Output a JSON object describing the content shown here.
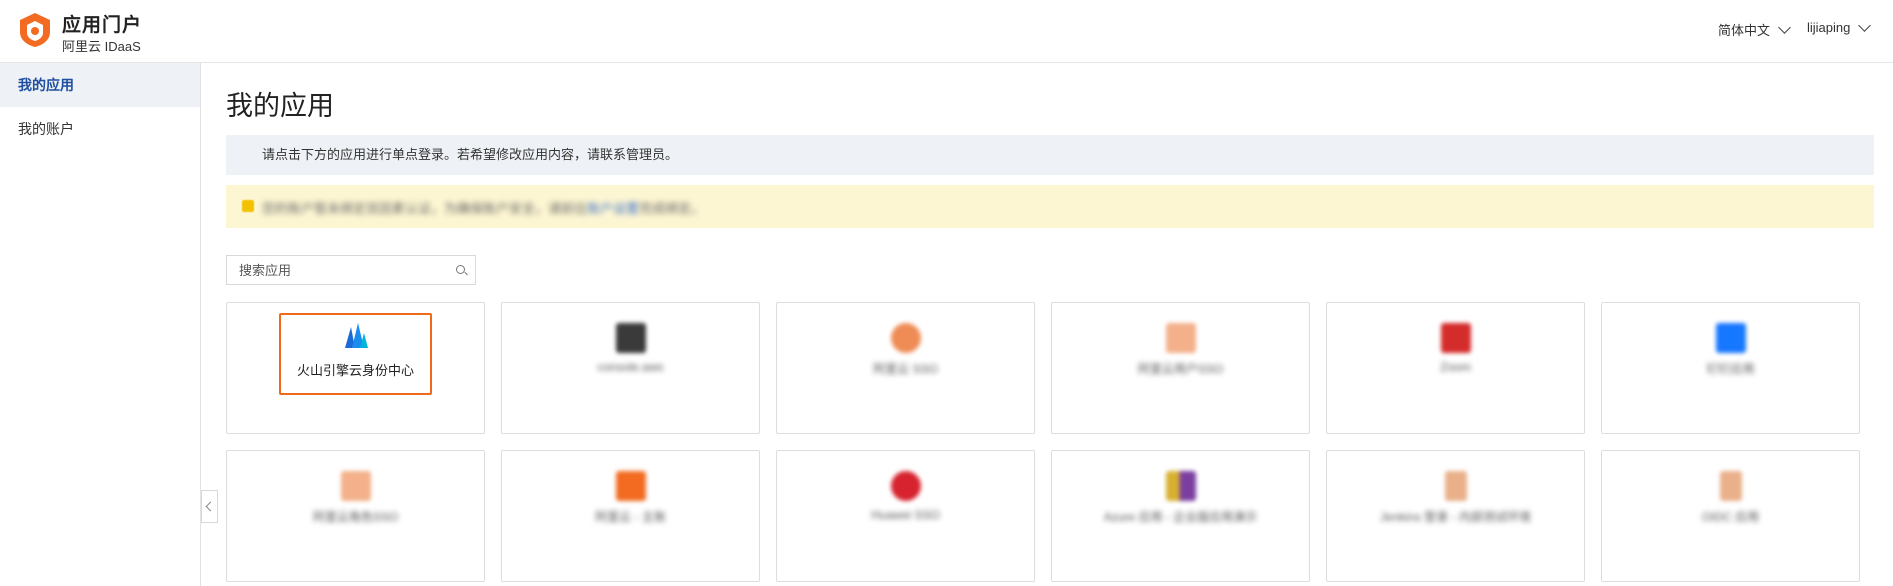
{
  "header": {
    "title": "应用门户",
    "subtitle": "阿里云 IDaaS",
    "language": "简体中文",
    "username": "lijiaping",
    "brand_color": "#f26b21"
  },
  "sidebar": {
    "items": [
      {
        "label": "我的应用",
        "active": true
      },
      {
        "label": "我的账户",
        "active": false
      }
    ]
  },
  "main": {
    "page_title": "我的应用",
    "notice": "请点击下方的应用进行单点登录。若希望修改应用内容，请联系管理员。",
    "warning": {
      "text": "您的账户暂未绑定双因素认证，为确保账户安全，请前往",
      "link": "账户设置",
      "suffix": "完成绑定。"
    },
    "search": {
      "placeholder": "搜索应用"
    },
    "apps": [
      {
        "name": "火山引擎云身份中心",
        "icon": "volcengine-logo-icon",
        "color": "#1a6bd8",
        "featured": true
      },
      {
        "name": "console.aws",
        "icon": "terminal-app-icon",
        "color": "#3a3a3a"
      },
      {
        "name": "阿里云 SSO",
        "icon": "flower-app-icon",
        "color": "#ef8c55"
      },
      {
        "name": "阿里云用户SSO",
        "icon": "bracket-app-icon",
        "color": "#f08a4b"
      },
      {
        "name": "Zoom",
        "icon": "z-app-icon",
        "color": "#d42b2b"
      },
      {
        "name": "钉钉应用",
        "icon": "dingtalk-app-icon",
        "color": "#1677ff"
      },
      {
        "name": "阿里云角色SSO",
        "icon": "bracket-app-icon",
        "color": "#f08a4b"
      },
      {
        "name": "阿里云 - 主账",
        "icon": "orange-app-icon",
        "color": "#f26b21"
      },
      {
        "name": "Huawei SSO",
        "icon": "huawei-app-icon",
        "color": "#d6232f"
      },
      {
        "name": "Azure 应用 - 企业版应用演示",
        "icon": "purple-app-icon",
        "color": "#7b3fa0"
      },
      {
        "name": "Jenkins 登录 - 内部测试环境",
        "icon": "d-app-icon",
        "color": "#e07a3c"
      },
      {
        "name": "OIDC 应用",
        "icon": "d-app-icon",
        "color": "#e07a3c"
      }
    ]
  }
}
